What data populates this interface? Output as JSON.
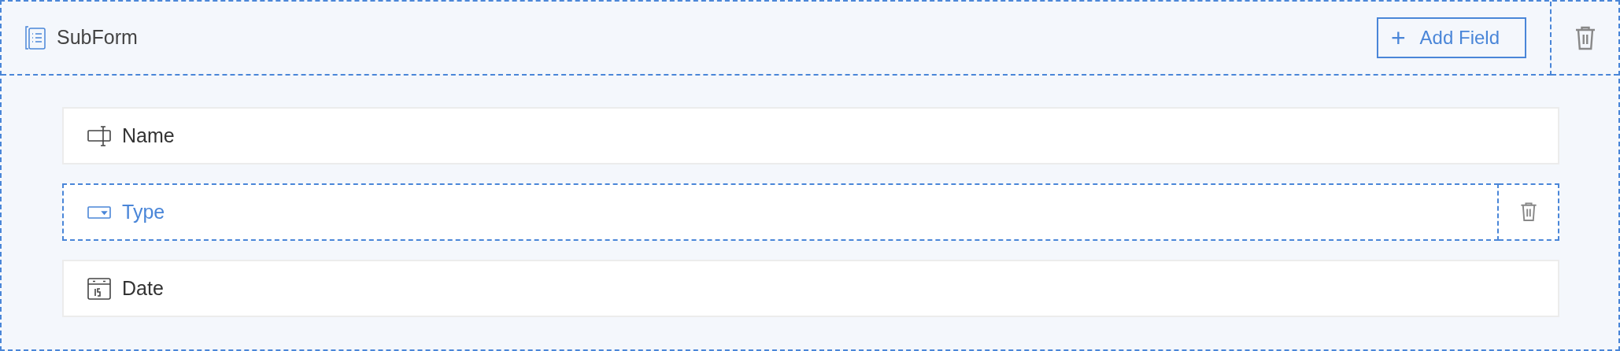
{
  "subform": {
    "title": "SubForm",
    "selected": true,
    "add_button": {
      "icon": "+",
      "label": "Add Field"
    }
  },
  "fields": [
    {
      "label": "Name",
      "kind": "text",
      "selected": false
    },
    {
      "label": "Type",
      "kind": "dropdown",
      "selected": true
    },
    {
      "label": "Date",
      "kind": "date",
      "selected": false
    }
  ]
}
